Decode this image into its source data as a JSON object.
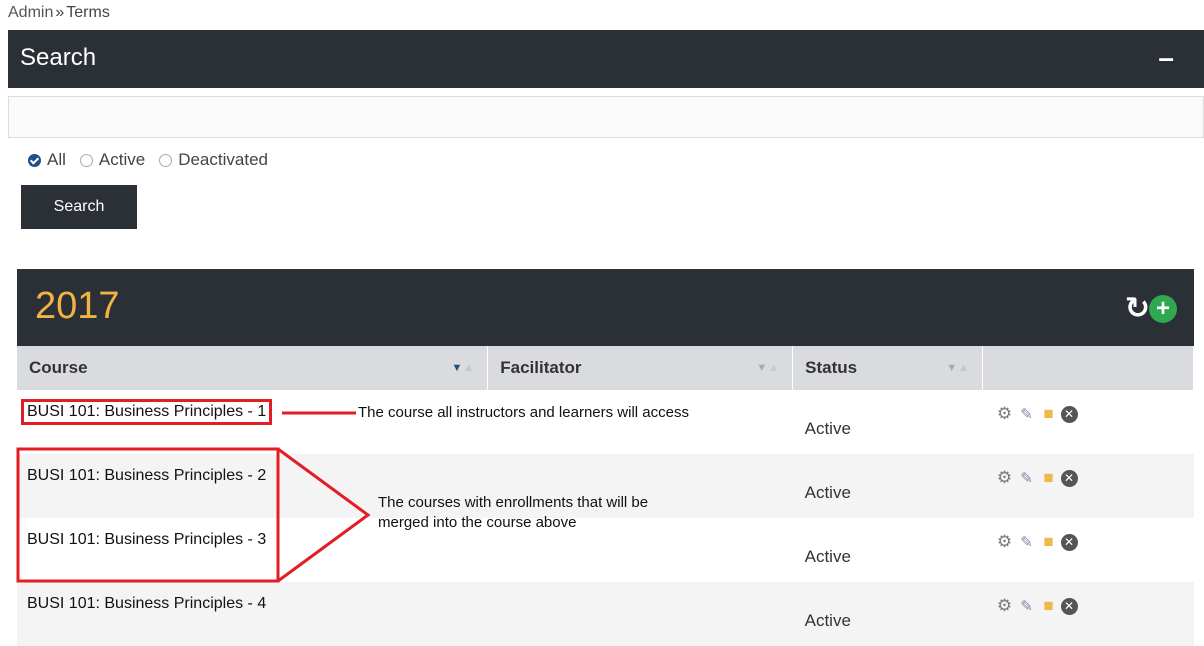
{
  "breadcrumb": {
    "root": "Admin",
    "separator": "»",
    "current": "Terms"
  },
  "search_panel": {
    "title": "Search",
    "collapse_label": "–",
    "input_value": "",
    "input_placeholder": ""
  },
  "filters": [
    {
      "label": "All",
      "checked": true
    },
    {
      "label": "Active",
      "checked": false
    },
    {
      "label": "Deactivated",
      "checked": false
    }
  ],
  "search_button": "Search",
  "term": {
    "year": "2017",
    "refresh_icon": "refresh-icon",
    "add_icon": "add-icon",
    "columns": [
      "Course",
      "Facilitator",
      "Status",
      ""
    ],
    "rows": [
      {
        "course": "BUSI 101: Business Principles - 1",
        "facilitator": "",
        "status": "Active"
      },
      {
        "course": "BUSI 101: Business Principles - 2",
        "facilitator": "",
        "status": "Active"
      },
      {
        "course": "BUSI 101: Business Principles - 3",
        "facilitator": "",
        "status": "Active"
      },
      {
        "course": "BUSI 101: Business Principles - 4",
        "facilitator": "",
        "status": "Active"
      }
    ],
    "row_actions": [
      "gear-icon",
      "edit-icon",
      "folder-icon",
      "close-icon"
    ]
  },
  "annotations": {
    "single": "The course all instructors and learners will access",
    "merged_line1": "The courses with enrollments that will be",
    "merged_line2": "merged into the course above",
    "color": "#e31d24"
  },
  "colors": {
    "header_bg": "#2b2f36",
    "year": "#f0b440",
    "accent": "#1f4e8c",
    "add": "#2fa84f"
  }
}
